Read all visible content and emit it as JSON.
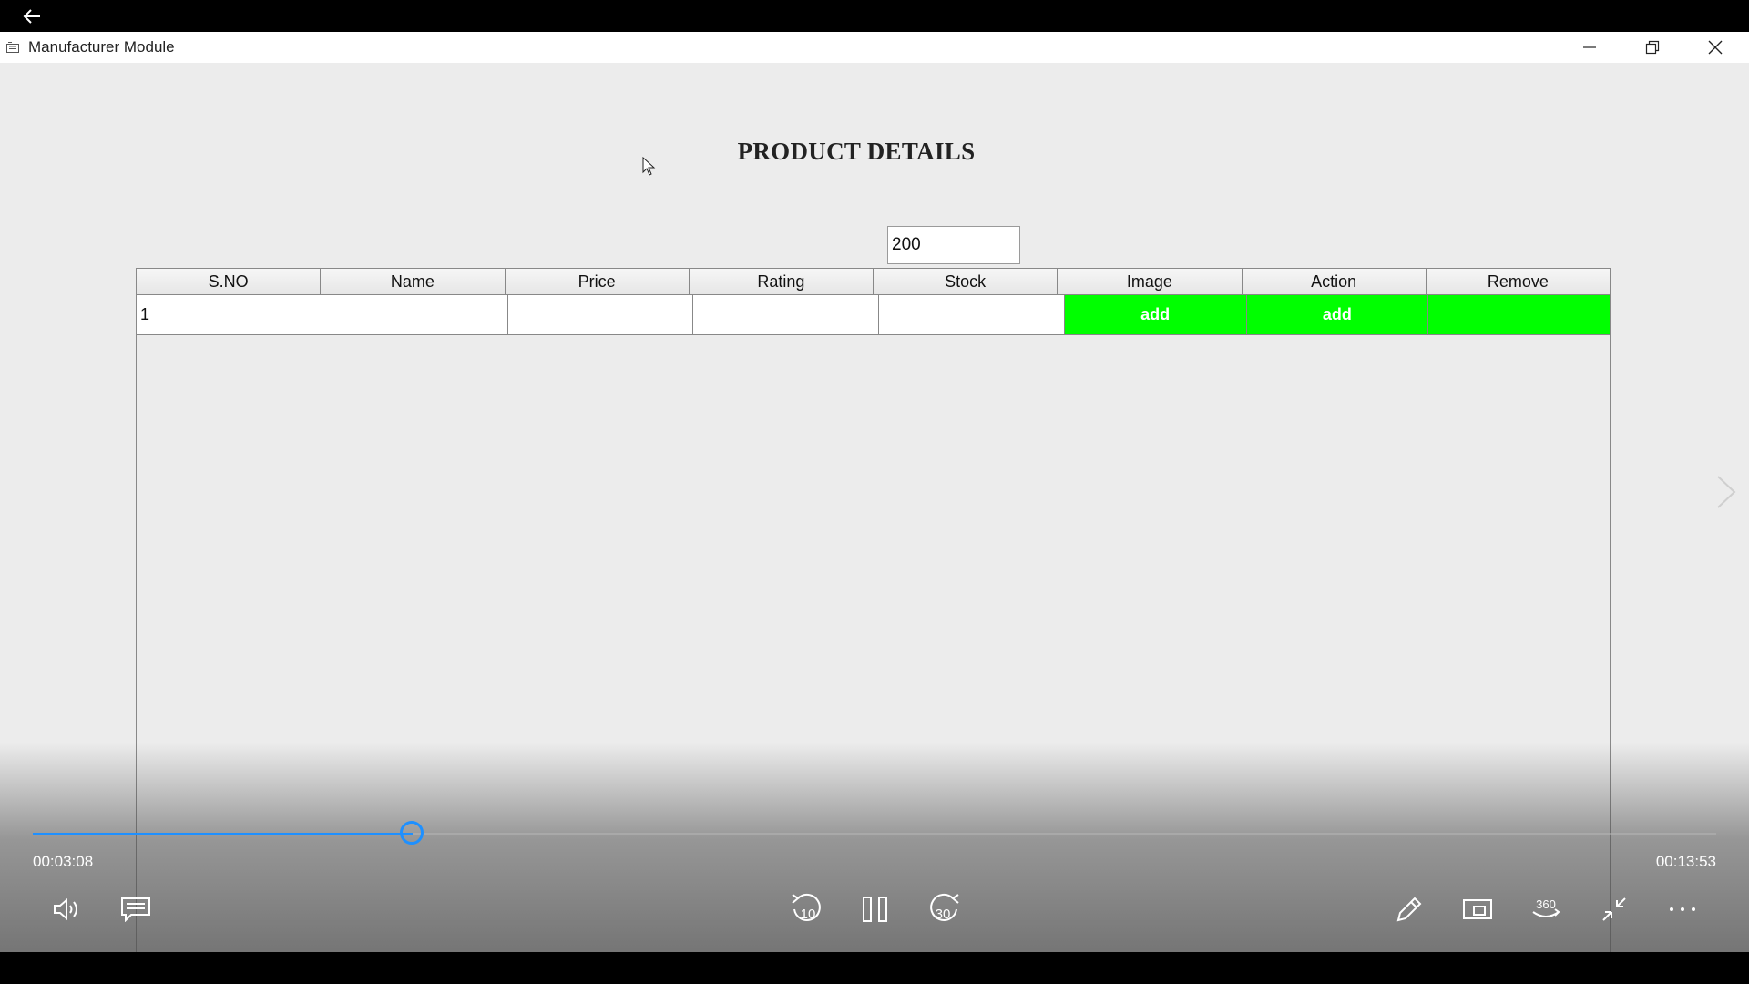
{
  "window": {
    "title": "Manufacturer Module",
    "controls": [
      "minimize-icon",
      "restore-icon",
      "close-icon"
    ]
  },
  "page": {
    "title": "PRODUCT DETAILS"
  },
  "search": {
    "value": "200"
  },
  "table": {
    "columns": [
      "S.NO",
      "Name",
      "Price",
      "Rating",
      "Stock",
      "Image",
      "Action",
      "Remove"
    ],
    "rows": [
      {
        "sno": "1",
        "name": "",
        "price": "",
        "rating": "",
        "stock": "",
        "image": "add",
        "action": "add",
        "remove": ""
      }
    ],
    "highlight_color": "#00ff00"
  },
  "player": {
    "elapsed": "00:03:08",
    "total": "00:13:53",
    "progress": 0.2257,
    "accent_color": "#1e90ff",
    "left_controls": [
      "volume-icon",
      "subtitles-icon"
    ],
    "center_controls": [
      "rewind-10-icon",
      "pause-icon",
      "forward-30-icon"
    ],
    "right_controls": [
      "pen-icon",
      "mini-view-icon",
      "360-view-icon",
      "exit-fullscreen-icon",
      "more-icon"
    ],
    "rewind_label": "10",
    "forward_label": "30",
    "view360_label": "360"
  }
}
